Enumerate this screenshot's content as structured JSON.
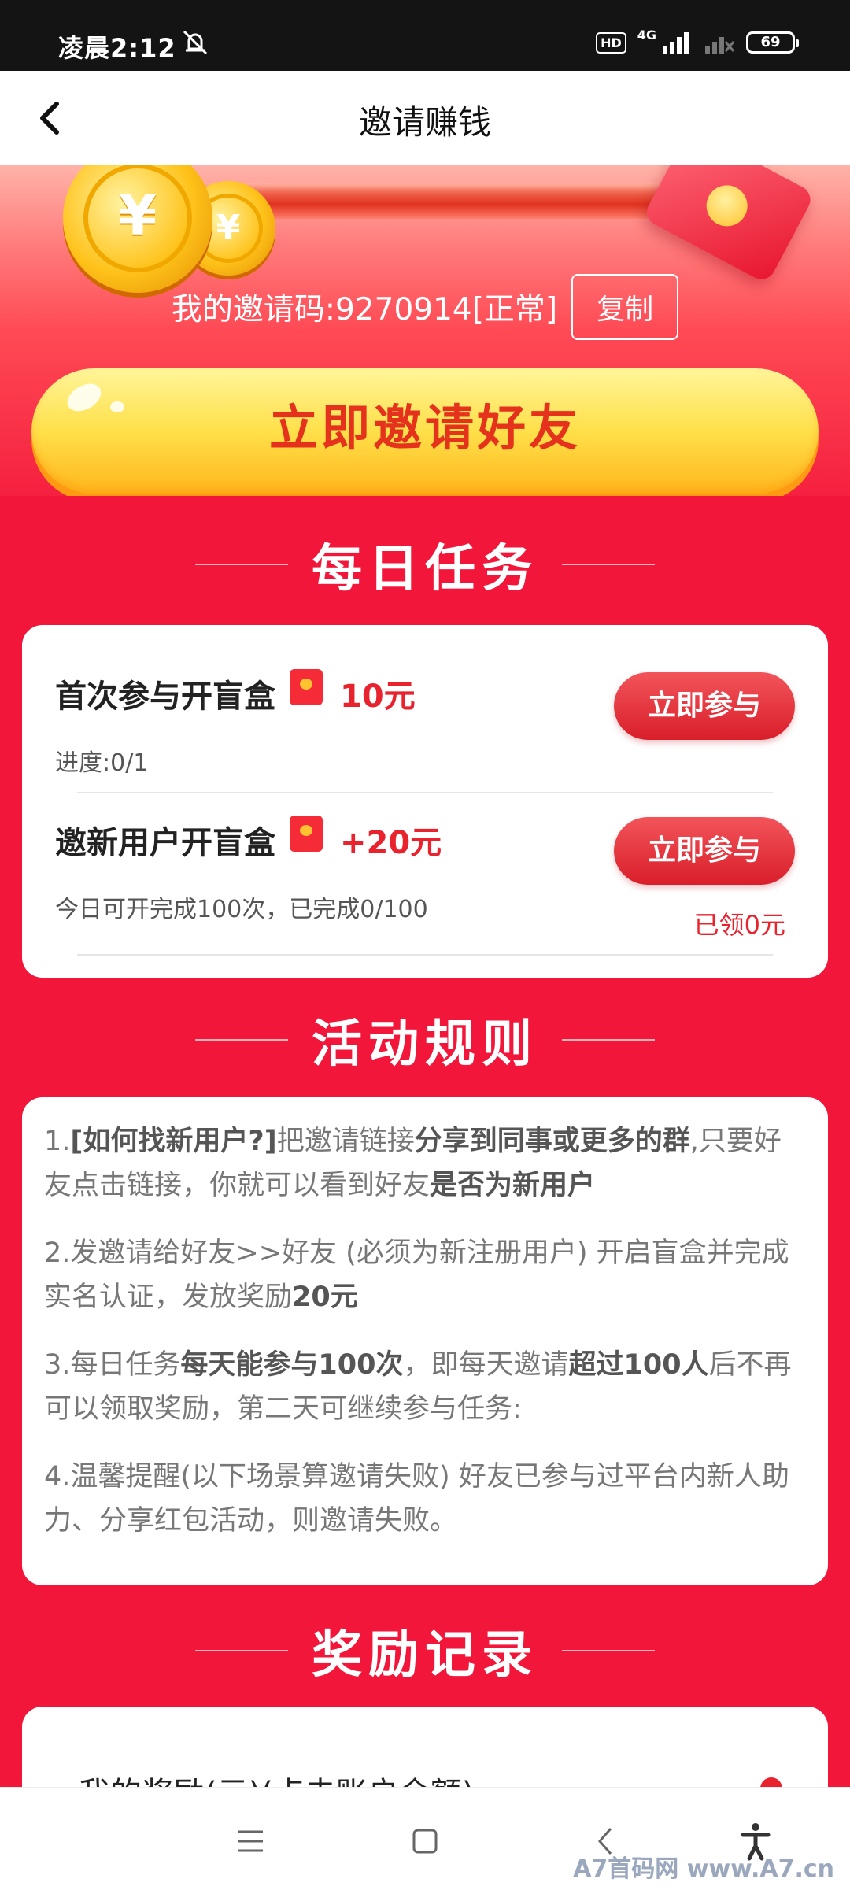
{
  "status": {
    "time": "凌晨2:12",
    "hd": "HD",
    "network": "4G",
    "battery": "69"
  },
  "header": {
    "title": "邀请赚钱"
  },
  "hero": {
    "invite_code": "我的邀请码:9270914[正常]",
    "copy_label": "复制",
    "invite_button": "立即邀请好友",
    "coin_symbol": "¥"
  },
  "sections": {
    "daily": "每日任务",
    "rules": "活动规则",
    "rewards": "奖励记录"
  },
  "tasks": [
    {
      "title": "首次参与开盲盒",
      "reward": "10元",
      "sub": "进度:0/1",
      "button": "立即参与"
    },
    {
      "title": "邀新用户开盲盒",
      "reward": "+20元",
      "sub": "今日可开完成100次，已完成0/100",
      "button": "立即参与",
      "claimed": "已领0元"
    }
  ],
  "rules": [
    {
      "parts": [
        "1.",
        "[如何找新用户?]",
        "把邀请链接",
        "分享到同事或更多的群",
        ",只要好友点击链接，你就可以看到好友",
        "是否为新用户"
      ]
    },
    {
      "parts": [
        "2.发邀请给好友>>好友 (必须为新注册用户) 开启盲盒并完成实名认证，发放奖励",
        "20元"
      ]
    },
    {
      "parts": [
        "3.每日任务",
        "每天能参与100次",
        "，即每天邀请",
        "超过100人",
        "后不再可以领取奖励，第二天可继续参与任务:"
      ]
    },
    {
      "parts": [
        "4.温馨提醒(以下场景算邀请失败) 好友已参与过平台内新人助力、分享红包活动，则邀请失败。"
      ]
    }
  ],
  "reward_record": {
    "label": "我的奖励(元)(点击账户余额)"
  },
  "watermark": "A7首码网  www.A7.cn",
  "colors": {
    "background": "#F2163A",
    "accent_red": "#E8232E",
    "button_yellow": "#FFE04A"
  }
}
